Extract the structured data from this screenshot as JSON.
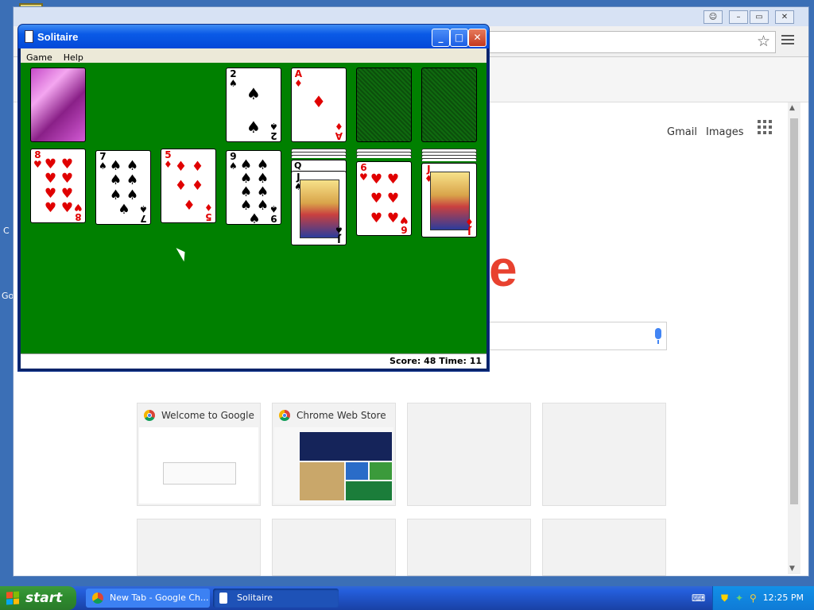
{
  "desktop": {
    "left_fragment_1": "C",
    "left_fragment_2": "Go"
  },
  "chrome": {
    "header_links": {
      "gmail": "Gmail",
      "images": "Images"
    },
    "logo_fragment": "e",
    "tiles": [
      {
        "title": "Welcome to Google C"
      },
      {
        "title": "Chrome Web Store"
      },
      {
        "title": ""
      },
      {
        "title": ""
      }
    ]
  },
  "solitaire": {
    "title": "Solitaire",
    "menu": [
      "Game",
      "Help"
    ],
    "status": "Score: 48 Time: 11",
    "foundations": [
      {
        "rank": "2",
        "suit": "♠",
        "color": "blk"
      },
      {
        "rank": "A",
        "suit": "♦",
        "color": "red"
      }
    ],
    "tableau": [
      {
        "rank": "8",
        "suit": "♥",
        "color": "red",
        "pips": 8
      },
      {
        "rank": "7",
        "suit": "♠",
        "color": "blk",
        "pips": 7
      },
      {
        "rank": "5",
        "suit": "♦",
        "color": "red",
        "pips": 5
      },
      {
        "rank": "9",
        "suit": "♠",
        "color": "blk",
        "pips": 9
      },
      {
        "rank": "J",
        "suit": "♠",
        "color": "blk",
        "hidden_behind": "Q"
      },
      {
        "rank": "6",
        "suit": "♥",
        "color": "red",
        "pips": 6
      },
      {
        "rank": "J",
        "suit": "♦",
        "color": "red"
      }
    ]
  },
  "taskbar": {
    "start_label": "start",
    "tasks": [
      {
        "label": "New Tab - Google Ch..."
      },
      {
        "label": "Solitaire"
      }
    ],
    "clock": "12:25 PM"
  },
  "colors": {
    "felt": "#008000",
    "xp_title": "#0a5ae6",
    "google_red": "#e8412f"
  }
}
